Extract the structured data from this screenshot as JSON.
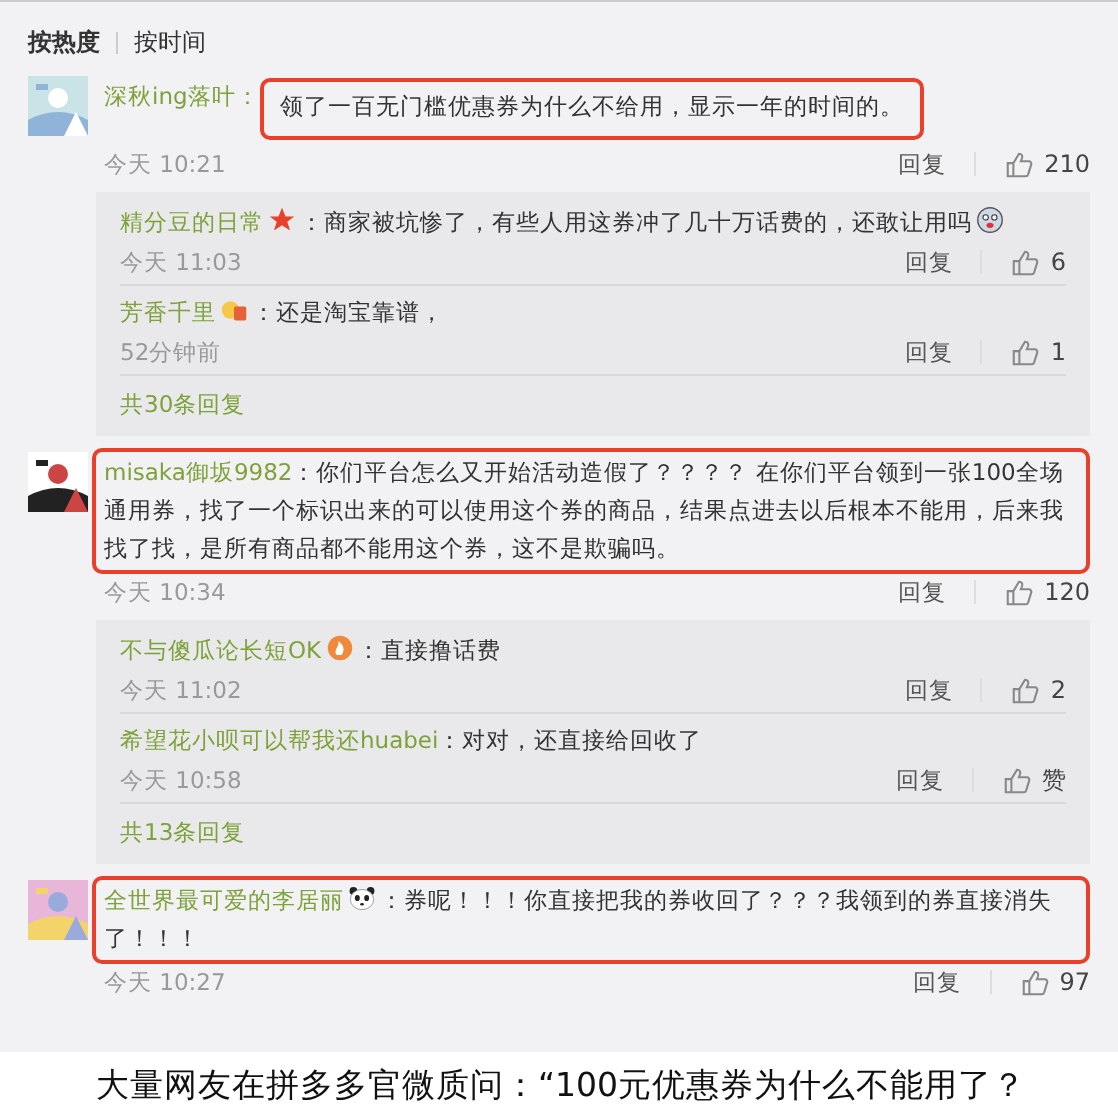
{
  "sort_tabs": [
    {
      "label": "按热度",
      "selected": true
    },
    {
      "label": "按时间",
      "selected": false
    }
  ],
  "comments": [
    {
      "author": "深秋ing落叶：",
      "text": "领了一百无门槛优惠券为什么不给用，显示一年的时间的。",
      "time": "今天 10:21",
      "reply_label": "回复",
      "likes": "210",
      "highlight": {
        "kind": "text"
      },
      "replies": [
        {
          "author": "精分豆的日常",
          "badge": {
            "kind": "star"
          },
          "text": "：商家被坑惨了，有些人用这券冲了几十万话费的，还敢让用吗",
          "emoji": {
            "kind": "face"
          },
          "time": "今天 11:03",
          "reply_label": "回复",
          "likes": "6"
        },
        {
          "author": "芳香千里",
          "badge": {
            "kind": "medal"
          },
          "text": "：还是淘宝靠谱，",
          "time": "52分钟前",
          "reply_label": "回复",
          "likes": "1"
        }
      ],
      "more_replies": "共30条回复"
    },
    {
      "author": "misaka御坂9982",
      "text": "：你们平台怎么又开始活动造假了？？？？  在你们平台领到一张100全场通用券，找了一个标识出来的可以使用这个券的商品，结果点进去以后根本不能用，后来我找了找，是所有商品都不能用这个券，这不是欺骗吗。",
      "time": "今天 10:34",
      "reply_label": "回复",
      "likes": "120",
      "highlight": {
        "kind": "body"
      },
      "replies": [
        {
          "author": "不与傻瓜论长短OK",
          "badge": {
            "kind": "flame"
          },
          "text": "：直接撸话费",
          "time": "今天 11:02",
          "reply_label": "回复",
          "likes": "2"
        },
        {
          "author": "希望花小呗可以帮我还huabei",
          "text": "：对对，还直接给回收了",
          "time": "今天 10:58",
          "reply_label": "回复",
          "likes": "赞"
        }
      ],
      "more_replies": "共13条回复"
    },
    {
      "author": "全世界最可爱的李居丽",
      "badge": {
        "kind": "panda"
      },
      "text": "：券呢！！！你直接把我的券收回了？？？我领到的券直接消失了！！！",
      "time": "今天 10:27",
      "reply_label": "回复",
      "likes": "97",
      "highlight": {
        "kind": "body"
      }
    }
  ],
  "caption": "大量网友在拼多多官微质问：“100元优惠券为什么不能用了？"
}
